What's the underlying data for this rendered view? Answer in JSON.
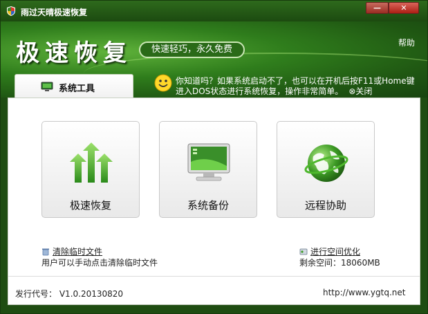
{
  "window": {
    "title": "雨过天晴极速恢复",
    "minimize_label": "—",
    "close_label": "✕"
  },
  "header": {
    "logo": "极速恢复",
    "slogan": "快速轻巧，永久免费",
    "help": "帮助",
    "tab_label": "系统工具",
    "tip_line1": "你知道吗？如果系统启动不了，也可以在开机后按F11或Home键",
    "tip_line2": "进入DOS状态进行系统恢复，操作非常简单。",
    "tip_close": "⊗关闭"
  },
  "tiles": [
    {
      "label": "极速恢复",
      "icon": "green-arrows-icon"
    },
    {
      "label": "系统备份",
      "icon": "monitor-icon"
    },
    {
      "label": "远程协助",
      "icon": "globe-icon"
    }
  ],
  "temp_files": {
    "link": "清除临时文件",
    "desc": "用户可以手动点击清除临时文件"
  },
  "space": {
    "link": "进行空间优化",
    "remaining_label": "剩余空间：",
    "remaining_value": "18060MB"
  },
  "footer": {
    "version_label": "发行代号：",
    "version": "V1.0.20130820",
    "url": "http://www.ygtq.net"
  },
  "colors": {
    "brand_green": "#2f7d1c",
    "close_red": "#ac1f14"
  }
}
